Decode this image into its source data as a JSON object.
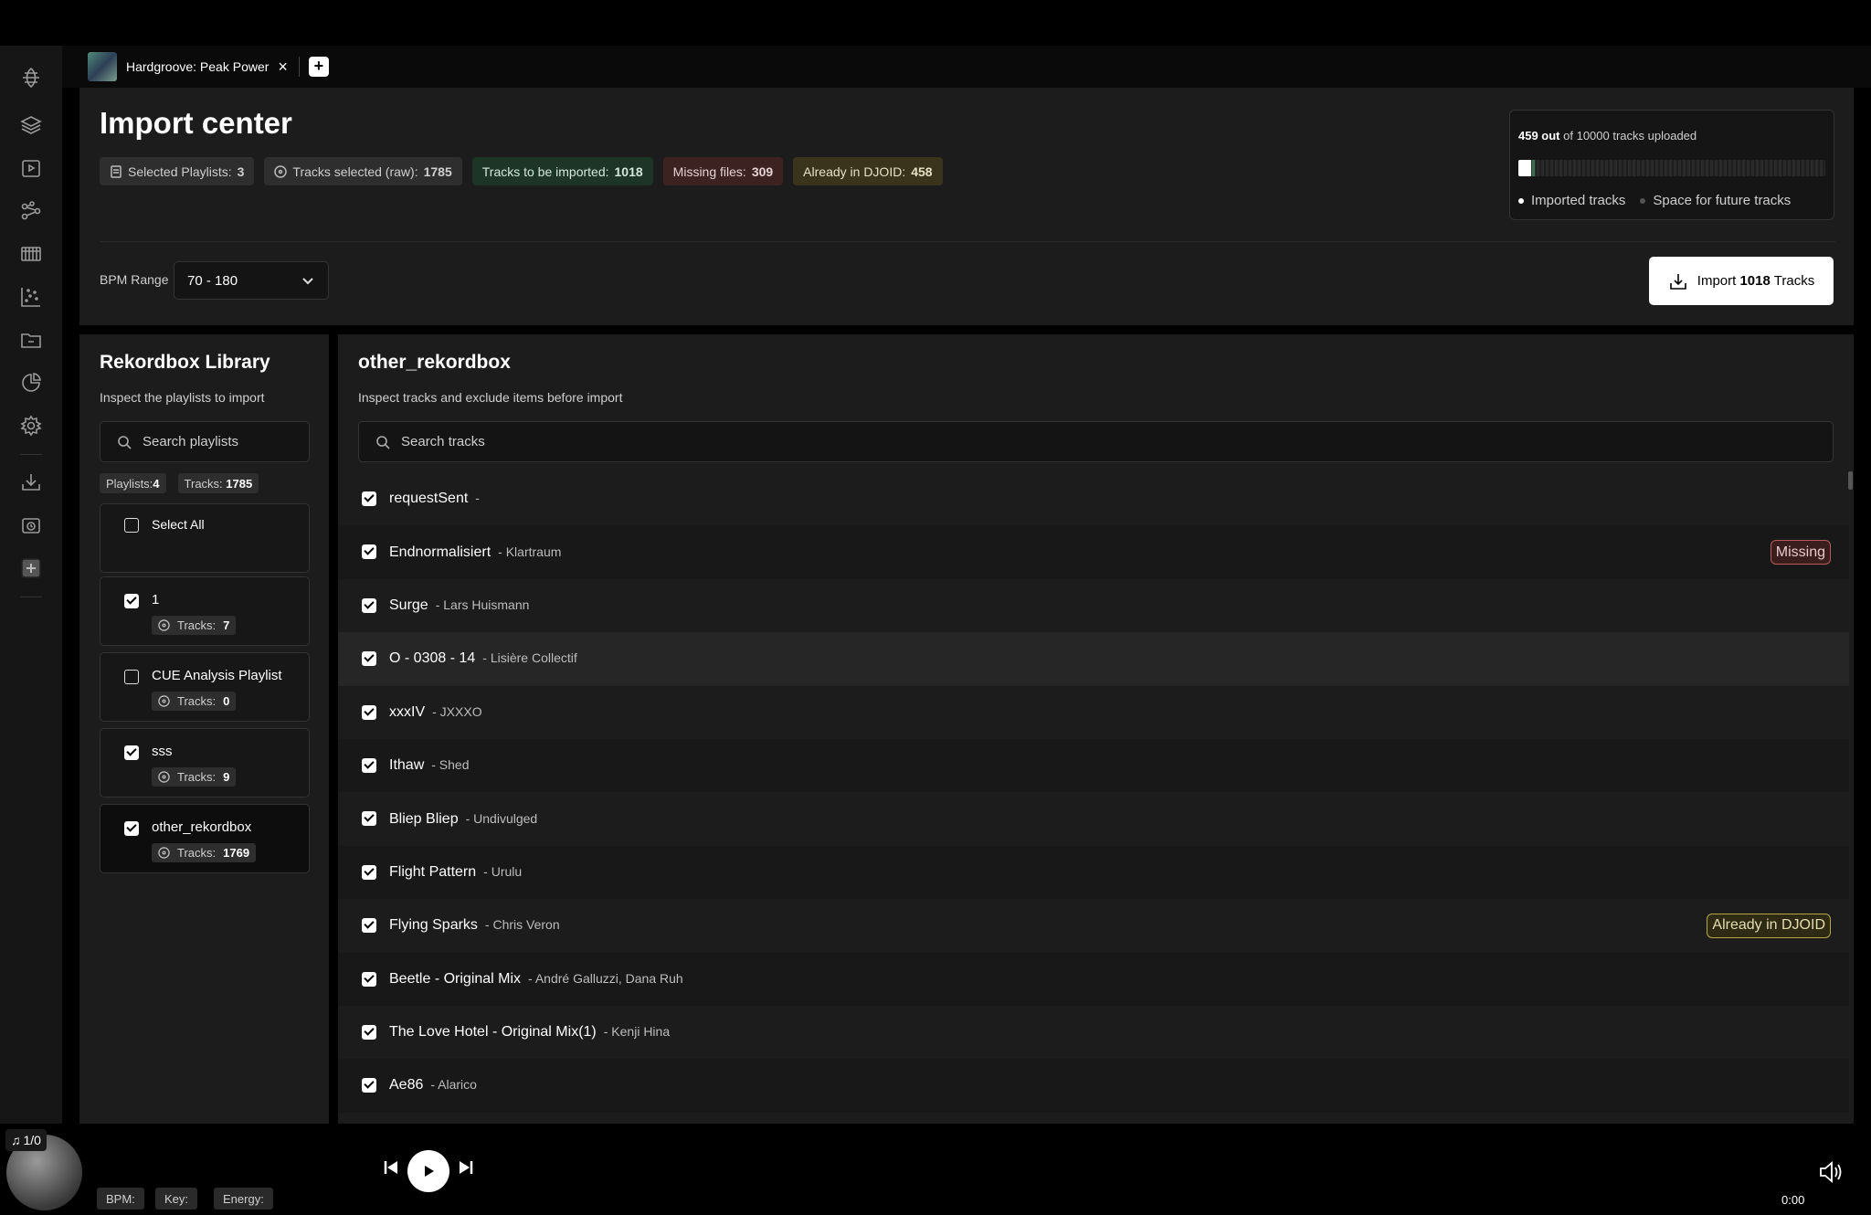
{
  "tab": {
    "title": "Hardgroove: Peak Power",
    "close_icon": "×",
    "add_icon": "+"
  },
  "sidebar_icons": [
    "logo-icon",
    "layers-icon",
    "music-folder-icon",
    "share-graph-icon",
    "crate-icon",
    "scatter-icon",
    "folder-icon",
    "pie-chart-icon",
    "gear-icon",
    "import-icon",
    "history-icon",
    "add-icon"
  ],
  "header": {
    "title": "Import center",
    "chips": [
      {
        "label": "Selected Playlists:",
        "value": "3",
        "style": "gray",
        "icon": "list-icon"
      },
      {
        "label": "Tracks selected (raw):",
        "value": "1785",
        "style": "gray",
        "icon": "disc-icon"
      },
      {
        "label": "Tracks to be imported:",
        "value": "1018",
        "style": "green"
      },
      {
        "label": "Missing files:",
        "value": "309",
        "style": "red"
      },
      {
        "label": "Already in DJOID:",
        "value": "458",
        "style": "yellow"
      }
    ],
    "quota": {
      "uploaded": "459 out",
      "total_text": "of 10000 tracks uploaded",
      "fraction": 0.0459,
      "legend_imported": "Imported tracks",
      "legend_space": "Space for future tracks"
    },
    "bpm_label": "BPM Range",
    "bpm_value": "70 - 180",
    "import_prefix": "Import",
    "import_count": "1018",
    "import_suffix": "Tracks"
  },
  "library": {
    "title": "Rekordbox Library",
    "subtitle": "Inspect the playlists to import",
    "search_placeholder": "Search playlists",
    "playlists_count_label": "Playlists:",
    "playlists_count": "4",
    "tracks_count_label": "Tracks:",
    "tracks_count": "1785",
    "select_all": "Select All",
    "tracks_label": "Tracks:",
    "playlists": [
      {
        "name": "1",
        "tracks": "7",
        "checked": true
      },
      {
        "name": "CUE Analysis Playlist",
        "tracks": "0",
        "checked": false
      },
      {
        "name": "sss",
        "tracks": "9",
        "checked": true
      },
      {
        "name": "other_rekordbox",
        "tracks": "1769",
        "checked": true,
        "active": true
      }
    ]
  },
  "tracks_panel": {
    "title": "other_rekordbox",
    "subtitle": "Inspect tracks and exclude items before import",
    "search_placeholder": "Search tracks",
    "tracks": [
      {
        "title": "requestSent",
        "artist": "-",
        "badge": ""
      },
      {
        "title": "Endnormalisiert",
        "artist": "- Klartraum",
        "badge": "Missing"
      },
      {
        "title": "Surge",
        "artist": "- Lars Huismann",
        "badge": ""
      },
      {
        "title": "O - 0308 - 14",
        "artist": "- Lisière Collectif",
        "badge": ""
      },
      {
        "title": "xxxIV",
        "artist": "- JXXXO",
        "badge": ""
      },
      {
        "title": "Ithaw",
        "artist": "- Shed",
        "badge": ""
      },
      {
        "title": "Bliep Bliep",
        "artist": "- Undivulged",
        "badge": ""
      },
      {
        "title": "Flight Pattern",
        "artist": "- Urulu",
        "badge": ""
      },
      {
        "title": "Flying Sparks",
        "artist": "- Chris Veron",
        "badge": "Already in DJOID"
      },
      {
        "title": "Beetle - Original Mix",
        "artist": "- André Galluzzi, Dana Ruh",
        "badge": ""
      },
      {
        "title": "The Love Hotel - Original Mix(1)",
        "artist": "- Kenji Hina",
        "badge": ""
      },
      {
        "title": "Ae86",
        "artist": "- Alarico",
        "badge": ""
      }
    ]
  },
  "player": {
    "counter": "1/0",
    "bpm": "BPM:",
    "key": "Key:",
    "energy": "Energy:",
    "time": "0:00"
  }
}
